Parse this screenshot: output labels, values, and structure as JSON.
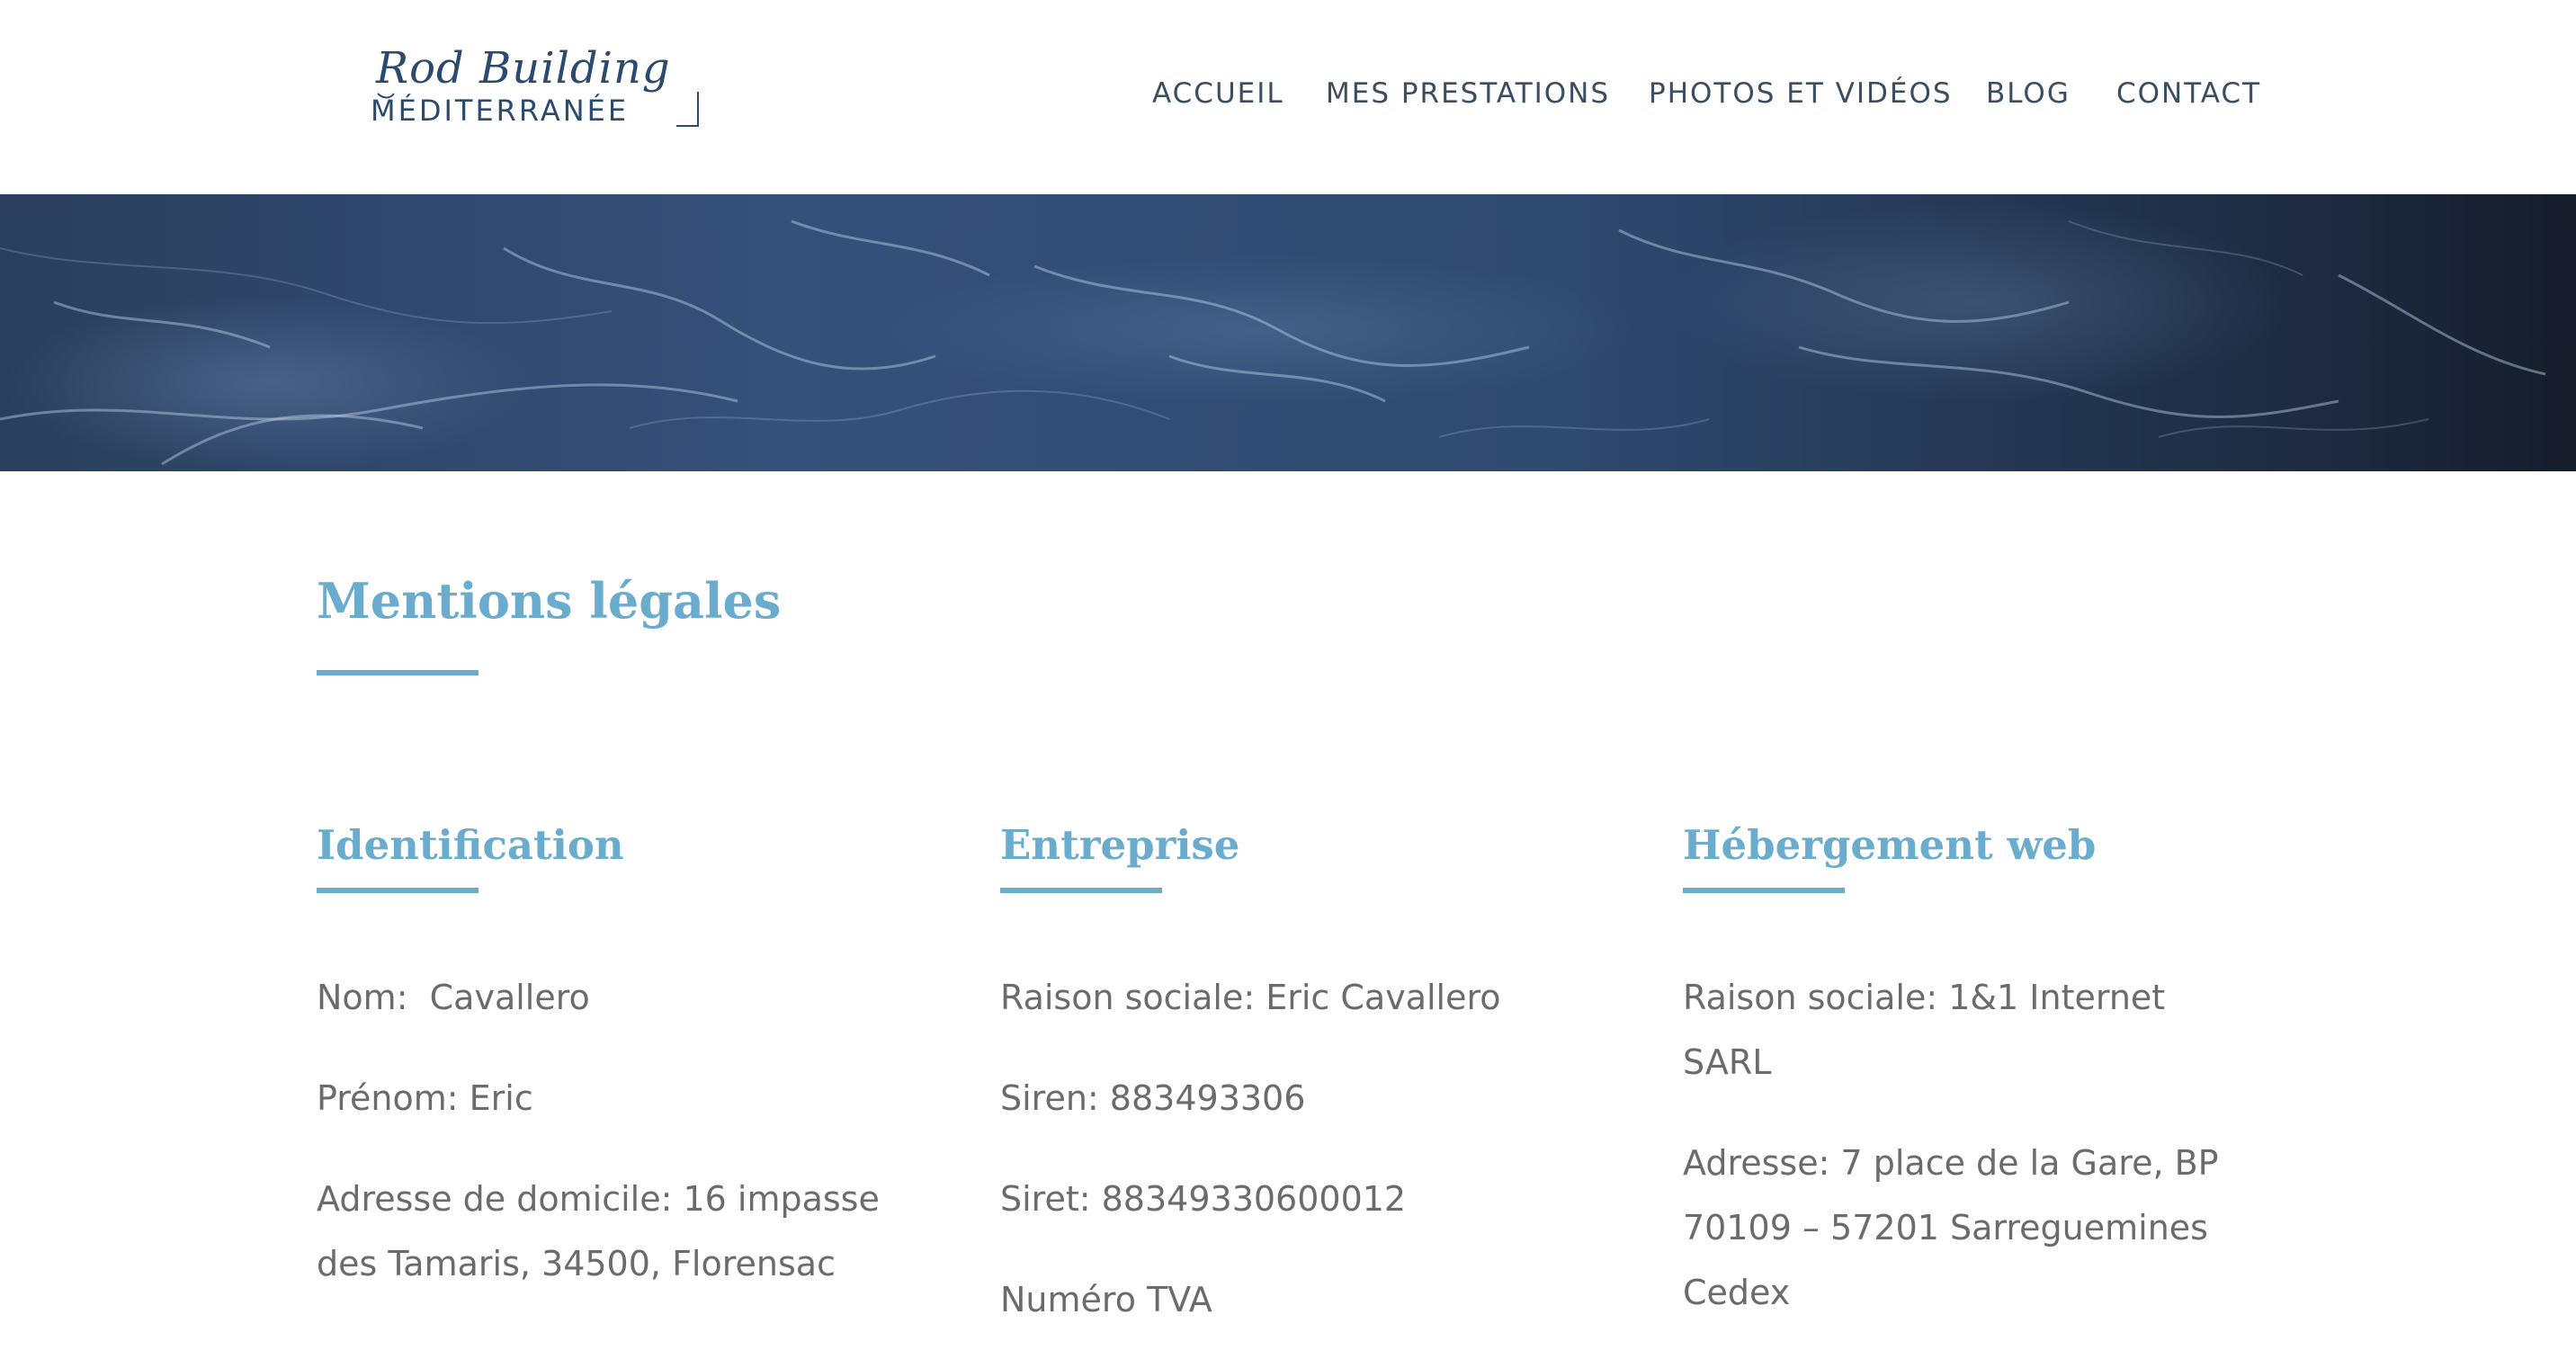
{
  "header": {
    "logo": {
      "script_text": "Rod Building",
      "caps_text": "MÉDITERRANÉE"
    },
    "nav": [
      {
        "label": "ACCUEIL"
      },
      {
        "label": "MES PRESTATIONS"
      },
      {
        "label": "PHOTOS ET VIDÉOS"
      },
      {
        "label": "BLOG"
      },
      {
        "label": "CONTACT"
      }
    ]
  },
  "main": {
    "title": "Mentions légales",
    "columns": [
      {
        "heading": "Identification",
        "paragraphs": [
          "Nom:  Cavallero",
          "Prénom: Eric",
          "Adresse de domicile: 16 impasse des Tamaris, 34500, Florensac"
        ]
      },
      {
        "heading": "Entreprise",
        "paragraphs": [
          "Raison sociale: Eric Cavallero",
          "Siren: 883493306",
          "Siret: 88349330600012",
          "Numéro TVA"
        ]
      },
      {
        "heading": "Hébergement web",
        "paragraphs": [
          "Raison sociale: 1&1 Internet SARL",
          "Adresse: 7 place de la Gare, BP 70109 – 57201 Sarreguemines Cedex"
        ]
      }
    ]
  },
  "colors": {
    "accent": "#6aaccd",
    "nav_text": "#3a4e63",
    "body_text": "#6b6b6b",
    "logo": "#2b4a6f"
  }
}
